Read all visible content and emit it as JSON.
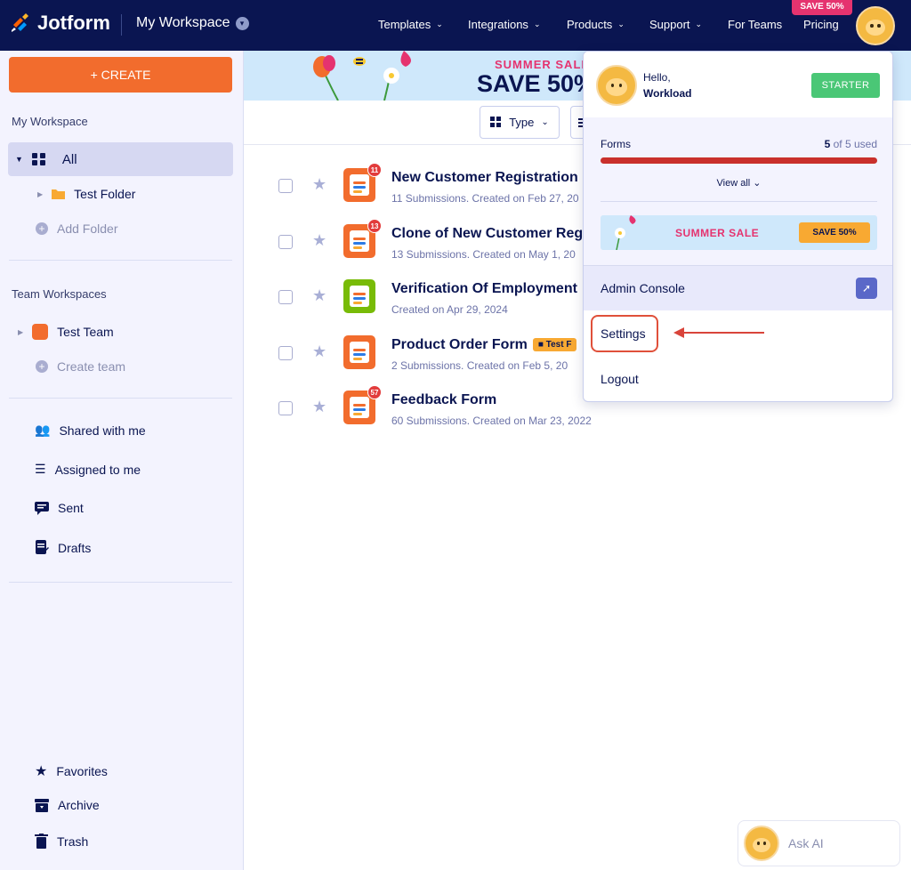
{
  "app": {
    "brand": "Jotform",
    "workspace": "My Workspace"
  },
  "nav": {
    "items": [
      "Templates",
      "Integrations",
      "Products",
      "Support",
      "For Teams",
      "Pricing"
    ],
    "promo_badge": "SAVE 50%"
  },
  "banner": {
    "title": "SUMMER SALE",
    "headline": "SAVE 50%"
  },
  "sidebar": {
    "create": "+ CREATE",
    "my_workspace": "My Workspace",
    "all": "All",
    "test_folder": "Test Folder",
    "add_folder": "Add Folder",
    "team_workspaces": "Team Workspaces",
    "test_team": "Test Team",
    "create_team": "Create team",
    "shared": "Shared with me",
    "assigned": "Assigned to me",
    "sent": "Sent",
    "drafts": "Drafts",
    "favorites": "Favorites",
    "archive": "Archive",
    "trash": "Trash"
  },
  "toolbar": {
    "type": "Type"
  },
  "forms": [
    {
      "title": "New Customer Registration",
      "meta": "11 Submissions. Created on Feb 27, 20",
      "badge": "11",
      "color": "#f26c2d"
    },
    {
      "title": "Clone of New Customer Reg",
      "meta": "13 Submissions. Created on May 1, 20",
      "badge": "13",
      "color": "#f26c2d"
    },
    {
      "title": "Verification Of Employment",
      "meta": "Created on Apr 29, 2024",
      "badge": "",
      "color": "#78bb07"
    },
    {
      "title": "Product Order Form",
      "meta": "2 Submissions. Created on Feb 5, 20",
      "badge": "",
      "color": "#f26c2d",
      "tag": "Test F"
    },
    {
      "title": "Feedback Form",
      "meta": "60 Submissions. Created on Mar 23, 2022",
      "badge": "57",
      "color": "#f26c2d"
    }
  ],
  "dropdown": {
    "hello": "Hello,",
    "name": "Workload",
    "plan": "STARTER",
    "usage_label": "Forms",
    "usage_used": "5",
    "usage_rest": " of 5 used",
    "usage_fraction": 1.0,
    "view_all": "View all",
    "sale_text": "SUMMER SALE",
    "sale_button": "SAVE 50%",
    "admin": "Admin Console",
    "settings": "Settings",
    "logout": "Logout"
  },
  "ask_ai": "Ask AI",
  "colors": {
    "navy": "#0a1551",
    "orange": "#f26c2d",
    "pink": "#e5336f",
    "green": "#4ac776",
    "red": "#c9302c"
  }
}
